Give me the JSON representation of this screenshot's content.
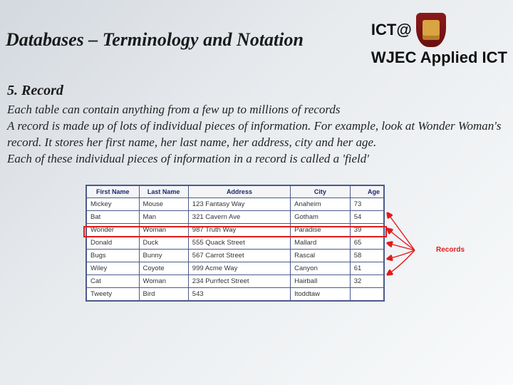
{
  "header": {
    "title": "Databases – Terminology and Notation",
    "brand_top": "ICT@",
    "brand_bottom": "WJEC Applied ICT"
  },
  "section": {
    "heading": "5. Record",
    "para1": "Each table can contain anything from a few up to millions of records",
    "para2": "A record is made up of lots of individual pieces of information. For example, look at Wonder Woman's record. It stores her first name, her last name, her address, city and her age.",
    "para3": "Each of these individual pieces of information in a record is called a 'field'"
  },
  "table": {
    "headers": [
      "First Name",
      "Last Name",
      "Address",
      "City",
      "Age"
    ],
    "rows": [
      [
        "Mickey",
        "Mouse",
        "123 Fantasy Way",
        "Anaheim",
        "73"
      ],
      [
        "Bat",
        "Man",
        "321 Cavern Ave",
        "Gotham",
        "54"
      ],
      [
        "Wonder",
        "Woman",
        "987 Truth Way",
        "Paradise",
        "39"
      ],
      [
        "Donald",
        "Duck",
        "555 Quack Street",
        "Mallard",
        "65"
      ],
      [
        "Bugs",
        "Bunny",
        "567 Carrot Street",
        "Rascal",
        "58"
      ],
      [
        "Wiley",
        "Coyote",
        "999 Acme Way",
        "Canyon",
        "61"
      ],
      [
        "Cat",
        "Woman",
        "234 Purrfect Street",
        "Hairball",
        "32"
      ],
      [
        "Tweety",
        "Bird",
        "543",
        "Itoddtaw",
        ""
      ]
    ],
    "callout": "Records"
  }
}
